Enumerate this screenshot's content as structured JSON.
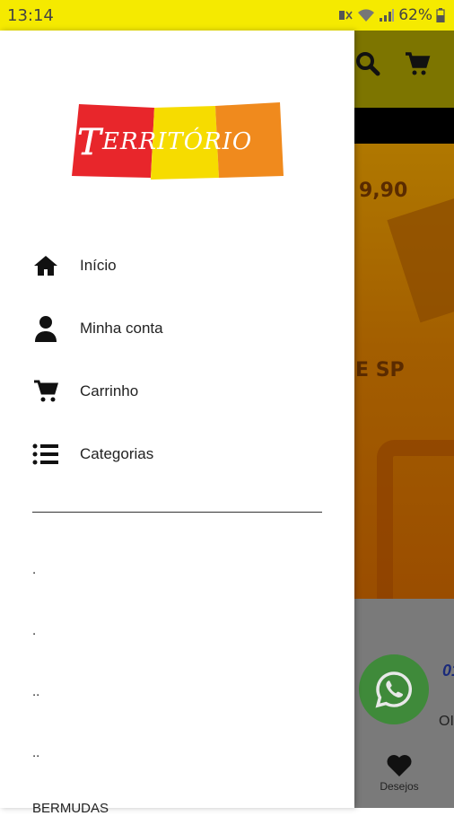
{
  "status_bar": {
    "time": "13:14",
    "battery": "62%"
  },
  "background_app": {
    "banner_price": "9,90",
    "banner_text": "E SP",
    "product_title_fragment": "01",
    "product_text_fragment": "OI",
    "wishlist_label": "Desejos"
  },
  "drawer": {
    "logo_text": "TERRITÓRIO",
    "menu": [
      {
        "label": "Início",
        "icon": "home-icon"
      },
      {
        "label": "Minha conta",
        "icon": "person-icon"
      },
      {
        "label": "Carrinho",
        "icon": "cart-icon"
      },
      {
        "label": "Categorias",
        "icon": "list-icon"
      }
    ],
    "categories": [
      ".",
      ".",
      "..",
      "..",
      "BERMUDAS"
    ]
  },
  "colors": {
    "status_bar": "#f5ea00",
    "logo_red": "#e8262b",
    "logo_yellow": "#f6dc00",
    "logo_orange": "#f08a1d",
    "whatsapp_green": "#3f8a3a"
  }
}
